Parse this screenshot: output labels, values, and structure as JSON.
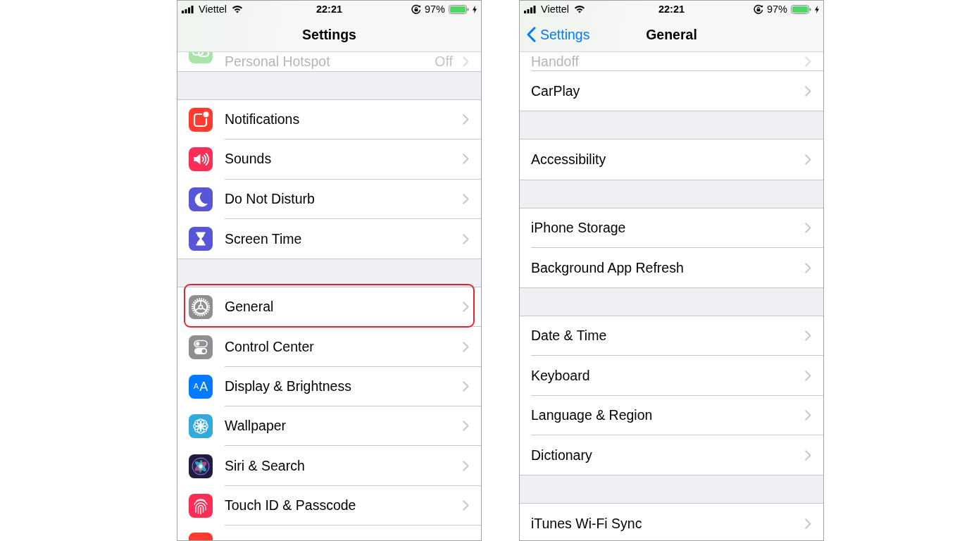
{
  "screens": [
    {
      "status_bar": {
        "carrier": "Viettel",
        "time": "22:21",
        "battery": "97%"
      },
      "nav_bar": {
        "title": "Settings"
      },
      "groups": [
        {
          "rows": [
            {
              "kind": "covered",
              "label": "Personal Hotspot",
              "value": "Off",
              "color": "#a9e5a9",
              "highlighted": false
            }
          ]
        },
        {
          "rows": [
            {
              "kind": "full",
              "label": "Notifications",
              "color": "#ff3b30",
              "highlighted": false
            },
            {
              "kind": "full",
              "label": "Sounds",
              "color": "#ff2d55",
              "highlighted": false
            },
            {
              "kind": "full",
              "label": "Do Not Disturb",
              "color": "#5856d6",
              "highlighted": false
            },
            {
              "kind": "full",
              "label": "Screen Time",
              "color": "#5856d6",
              "highlighted": false
            }
          ]
        },
        {
          "rows": [
            {
              "kind": "full",
              "label": "General",
              "color": "#8e8e93",
              "highlighted": true
            },
            {
              "kind": "full",
              "label": "Control Center",
              "color": "#8e8e93",
              "highlighted": false
            },
            {
              "kind": "full",
              "label": "Display & Brightness",
              "color": "#007aff",
              "icon_letters": [
                "A",
                "A"
              ],
              "highlighted": false
            },
            {
              "kind": "full",
              "label": "Wallpaper",
              "color": "#34aadc",
              "highlighted": false
            },
            {
              "kind": "full",
              "label": "Siri & Search",
              "color": "#201c3e",
              "highlighted": false
            },
            {
              "kind": "full",
              "label": "Touch ID & Passcode",
              "color": "#ff2d55",
              "highlighted": false
            },
            {
              "kind": "cut",
              "color": "#ff3b30",
              "highlighted": false
            }
          ]
        }
      ]
    },
    {
      "status_bar": {
        "carrier": "Viettel",
        "time": "22:21",
        "battery": "97%"
      },
      "nav_bar": {
        "back": "Settings",
        "title": "General"
      },
      "groups": [
        {
          "rows": [
            {
              "kind": "covered",
              "label": "Handoff",
              "highlighted": false
            },
            {
              "kind": "full",
              "label": "CarPlay",
              "highlighted": false
            }
          ]
        },
        {
          "rows": [
            {
              "kind": "full",
              "label": "Accessibility",
              "highlighted": false
            }
          ]
        },
        {
          "rows": [
            {
              "kind": "full",
              "label": "iPhone Storage",
              "highlighted": false
            },
            {
              "kind": "full",
              "label": "Background App Refresh",
              "highlighted": false
            }
          ]
        },
        {
          "rows": [
            {
              "kind": "full",
              "label": "Date & Time",
              "highlighted": false
            },
            {
              "kind": "full",
              "label": "Keyboard",
              "highlighted": false
            },
            {
              "kind": "full",
              "label": "Language & Region",
              "highlighted": false
            },
            {
              "kind": "full",
              "label": "Dictionary",
              "highlighted": false
            }
          ]
        },
        {
          "rows": [
            {
              "kind": "full",
              "label": "iTunes Wi-Fi Sync",
              "highlighted": false
            }
          ]
        }
      ]
    }
  ]
}
